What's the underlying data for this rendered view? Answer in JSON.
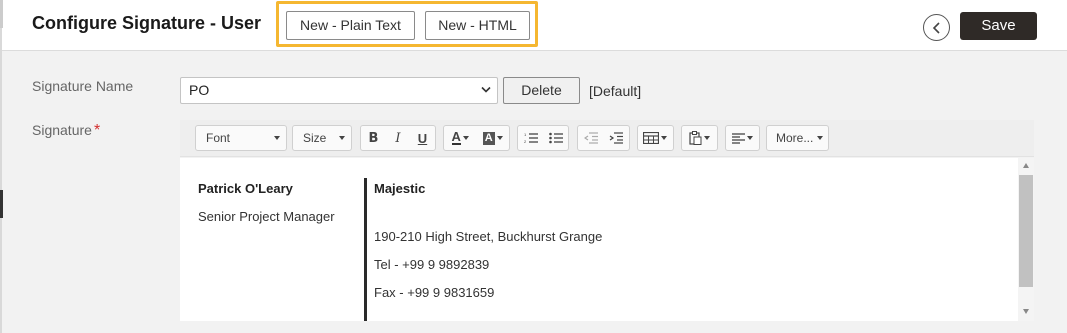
{
  "header": {
    "title": "Configure Signature - User",
    "new_plain_text_label": "New - Plain Text",
    "new_html_label": "New - HTML",
    "save_label": "Save",
    "highlight_color": "#f5b731",
    "save_bg_color": "#2f2a27"
  },
  "form": {
    "signature_name_label": "Signature Name",
    "signature_name_value": "PO",
    "delete_label": "Delete",
    "default_tag": "[Default]",
    "signature_label": "Signature",
    "required_mark": "*"
  },
  "toolbar": {
    "font_label": "Font",
    "size_label": "Size",
    "more_label": "More...",
    "icons": [
      "bold-icon",
      "italic-icon",
      "underline-icon",
      "font-color-icon",
      "highlight-color-icon",
      "numbered-list-icon",
      "bullet-list-icon",
      "outdent-icon",
      "indent-icon",
      "table-icon",
      "paste-icon",
      "align-icon"
    ]
  },
  "signature": {
    "name": "Patrick O'Leary",
    "title": "Senior Project Manager",
    "company": "Majestic",
    "address": "190-210 High Street, Buckhurst Grange",
    "tel": "Tel - +99 9 9892839",
    "fax": "Fax - +99 9 9831659"
  }
}
